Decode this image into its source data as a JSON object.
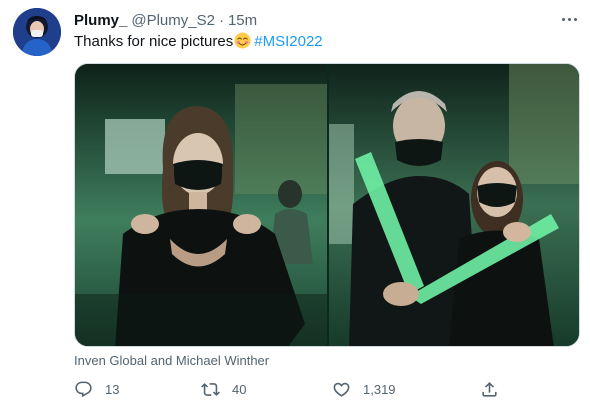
{
  "tweet": {
    "display_name": "Plumy_",
    "handle": "@Plumy_S2",
    "separator": "·",
    "time": "15m",
    "text": "Thanks for nice pictures",
    "emoji": "smiling-face-with-blush",
    "hashtag": "#MSI2022",
    "tagged": "Inven Global and Michael Winther",
    "media_count": 2
  },
  "actions": {
    "reply_count": "13",
    "retweet_count": "40",
    "like_count": "1,319"
  },
  "icons": [
    "more-icon",
    "reply-icon",
    "retweet-icon",
    "like-icon",
    "share-icon"
  ],
  "colors": {
    "link": "#1d9bf0",
    "text": "#0f1419",
    "secondary": "#536471",
    "border": "#cfd9de"
  }
}
